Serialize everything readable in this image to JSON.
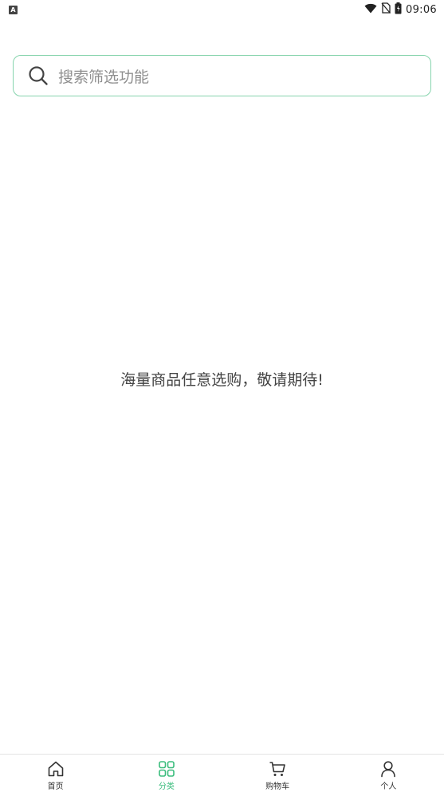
{
  "status_bar": {
    "left_badge": "A",
    "time": "09:06",
    "icons": [
      "wifi-icon",
      "no-sim-icon",
      "battery-icon"
    ]
  },
  "search": {
    "placeholder": "搜索筛选功能",
    "icon": "search-icon"
  },
  "main": {
    "message": "海量商品任意选购，敬请期待!"
  },
  "bottom_nav": {
    "items": [
      {
        "label": "首页",
        "icon": "home-icon",
        "active": false
      },
      {
        "label": "分类",
        "icon": "grid-icon",
        "active": true
      },
      {
        "label": "购物车",
        "icon": "cart-icon",
        "active": false
      },
      {
        "label": "个人",
        "icon": "person-icon",
        "active": false
      }
    ]
  },
  "colors": {
    "accent": "#3bbd7d",
    "search_border": "#86d4ad",
    "text_primary": "#444444",
    "placeholder": "#8f8f8f"
  }
}
